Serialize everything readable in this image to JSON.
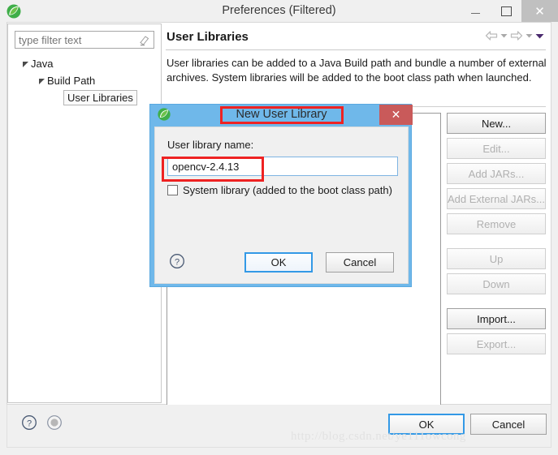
{
  "window": {
    "title": "Preferences (Filtered)",
    "logo_icon": "eclipse-leaf-icon",
    "minimize_label": "",
    "maximize_label": "",
    "close_label": "✕"
  },
  "filter": {
    "placeholder": "type filter text",
    "value": "",
    "clear_icon": "eraser-icon"
  },
  "tree": {
    "items": [
      {
        "label": "Java",
        "level": 1,
        "expanded": true,
        "selected": false
      },
      {
        "label": "Build Path",
        "level": 2,
        "expanded": true,
        "selected": false
      },
      {
        "label": "User Libraries",
        "level": 3,
        "expanded": false,
        "selected": true
      }
    ]
  },
  "content": {
    "page_title": "User Libraries",
    "description": "User libraries can be added to a Java Build path and bundle a number of external archives. System libraries will be added to the boot class path when launched.",
    "nav": {
      "back_icon": "arrow-left-icon",
      "back_menu_icon": "chevron-down-icon",
      "forward_icon": "arrow-right-icon",
      "forward_menu_icon": "chevron-down-icon",
      "view_menu_icon": "chevron-down-filled-icon"
    },
    "buttons": [
      {
        "label": "New...",
        "enabled": true
      },
      {
        "label": "Edit...",
        "enabled": false
      },
      {
        "label": "Add JARs...",
        "enabled": false
      },
      {
        "label": "Add External JARs...",
        "enabled": false
      },
      {
        "label": "Remove",
        "enabled": false
      },
      {
        "label": "Up",
        "enabled": false,
        "group_break": true
      },
      {
        "label": "Down",
        "enabled": false
      },
      {
        "label": "Import...",
        "enabled": true,
        "group_break": true
      },
      {
        "label": "Export...",
        "enabled": false
      }
    ]
  },
  "footer": {
    "help_icon": "question-mark-icon",
    "apply_icon": "apply-circle-icon",
    "ok_label": "OK",
    "cancel_label": "Cancel"
  },
  "watermark": {
    "text": "http://blog.csdn.net/ye111owcong"
  },
  "dialog": {
    "title": "New User Library",
    "logo_icon": "eclipse-leaf-icon",
    "close_label": "✕",
    "name_label": "User library name:",
    "name_value": "opencv-2.4.13",
    "system_library_label": "System library (added to the boot class path)",
    "system_library_checked": false,
    "help_icon": "question-mark-icon",
    "ok_label": "OK",
    "cancel_label": "Cancel"
  },
  "annotations": [
    {
      "name": "dialog-title-highlight",
      "color": "#ee2222"
    },
    {
      "name": "library-name-highlight",
      "color": "#ee2222"
    }
  ]
}
